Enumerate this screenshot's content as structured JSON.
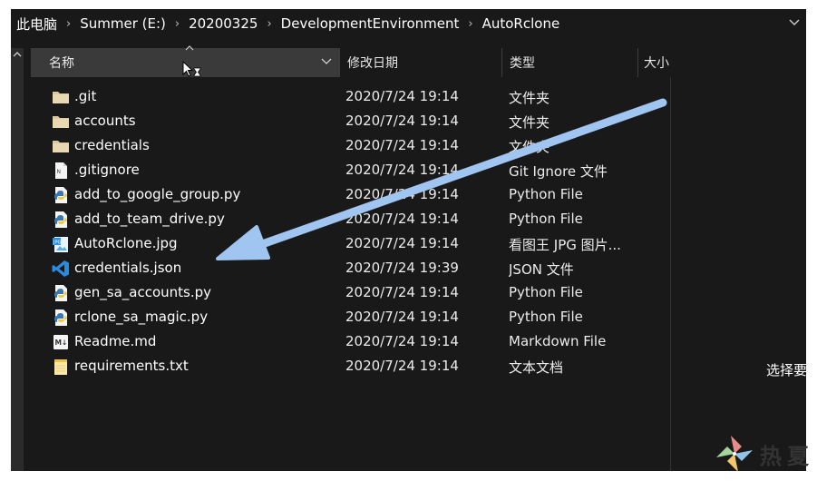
{
  "breadcrumb": [
    "此电脑",
    "Summer (E:)",
    "20200325",
    "DevelopmentEnvironment",
    "AutoRclone"
  ],
  "columns": {
    "name": "名称",
    "date": "修改日期",
    "type": "类型",
    "size": "大小"
  },
  "files": [
    {
      "name": ".git",
      "date": "2020/7/24 19:14",
      "type": "文件夹",
      "icon": "folder-icon"
    },
    {
      "name": "accounts",
      "date": "2020/7/24 19:14",
      "type": "文件夹",
      "icon": "folder-icon"
    },
    {
      "name": "credentials",
      "date": "2020/7/24 19:14",
      "type": "文件夹",
      "icon": "folder-icon"
    },
    {
      "name": ".gitignore",
      "date": "2020/7/24 19:14",
      "type": "Git Ignore 文件",
      "icon": "text-file-icon"
    },
    {
      "name": "add_to_google_group.py",
      "date": "2020/7/24 19:14",
      "type": "Python File",
      "icon": "python-file-icon"
    },
    {
      "name": "add_to_team_drive.py",
      "date": "2020/7/24 19:14",
      "type": "Python File",
      "icon": "python-file-icon"
    },
    {
      "name": "AutoRclone.jpg",
      "date": "2020/7/24 19:14",
      "type": "看图王 JPG 图片...",
      "icon": "image-file-icon"
    },
    {
      "name": "credentials.json",
      "date": "2020/7/24 19:39",
      "type": "JSON 文件",
      "icon": "vscode-file-icon"
    },
    {
      "name": "gen_sa_accounts.py",
      "date": "2020/7/24 19:14",
      "type": "Python File",
      "icon": "python-file-icon"
    },
    {
      "name": "rclone_sa_magic.py",
      "date": "2020/7/24 19:14",
      "type": "Python File",
      "icon": "python-file-icon"
    },
    {
      "name": "Readme.md",
      "date": "2020/7/24 19:14",
      "type": "Markdown File",
      "icon": "markdown-file-icon"
    },
    {
      "name": "requirements.txt",
      "date": "2020/7/24 19:14",
      "type": "文本文档",
      "icon": "notepad-file-icon"
    }
  ],
  "side_text": "选择要",
  "watermark": "热夏",
  "colors": {
    "background": "#191919",
    "header_selected": "#3a3a3a",
    "arrow": "#9fc5f0",
    "folder": "#dcc9a0"
  }
}
